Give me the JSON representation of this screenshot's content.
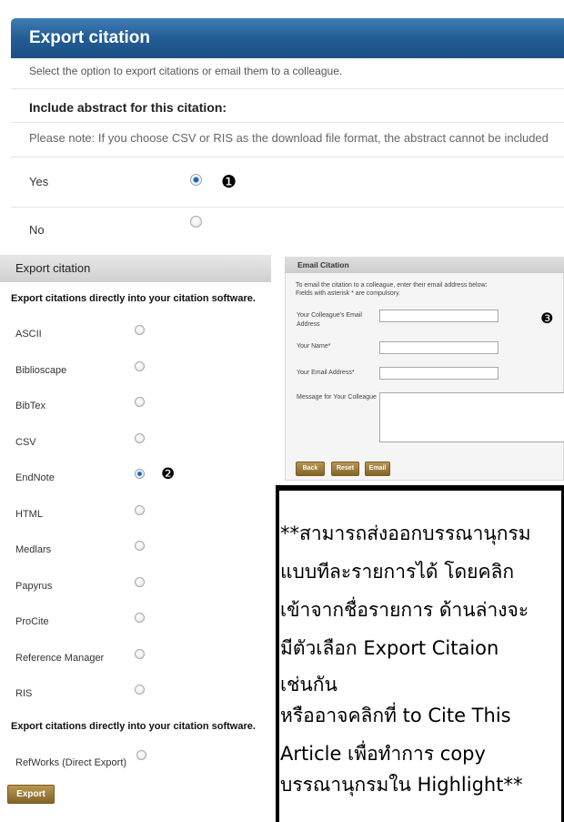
{
  "export_options": {
    "title": "Export citation",
    "intro": "Select the option to export citations or email them to a colleague.",
    "abstract_heading": "Include abstract for this citation:",
    "note": "Please note: If you choose CSV or RIS as the download file format, the abstract cannot be included",
    "choices": [
      {
        "label": "Yes",
        "selected": true
      },
      {
        "label": "No",
        "selected": false
      }
    ],
    "step_marker": "❶"
  },
  "format_panel": {
    "title": "Export citation",
    "software_heading": "Export citations directly into your citation software.",
    "formats": [
      {
        "label": "ASCII",
        "selected": false
      },
      {
        "label": "Biblioscape",
        "selected": false
      },
      {
        "label": "BibTex",
        "selected": false
      },
      {
        "label": "CSV",
        "selected": false
      },
      {
        "label": "EndNote",
        "selected": true
      },
      {
        "label": "HTML",
        "selected": false
      },
      {
        "label": "Medlars",
        "selected": false
      },
      {
        "label": "Papyrus",
        "selected": false
      },
      {
        "label": "ProCite",
        "selected": false
      },
      {
        "label": "Reference Manager",
        "selected": false
      },
      {
        "label": "RIS",
        "selected": false
      }
    ],
    "step_marker": "❷",
    "software_heading_2": "Export citations directly into your citation software.",
    "refworks": {
      "label": "RefWorks (Direct Export)",
      "selected": false
    },
    "export_button": "Export"
  },
  "email_panel": {
    "title": "Email Citation",
    "instructions": [
      "To email the citation to a colleague, enter their email address below:",
      "Fields with asterisk * are compulsory."
    ],
    "fields": [
      {
        "label": "Your Colleague's Email Address"
      },
      {
        "label": "Your Name*"
      },
      {
        "label": "Your Email Address*"
      },
      {
        "label": "Message for Your Colleague"
      }
    ],
    "step_marker": "❸",
    "buttons": [
      "Back",
      "Reset",
      "Email"
    ]
  },
  "note_box": {
    "lines": [
      "**สามารถส่งออกบรรณานุกรม",
      "แบบทีละรายการได้ โดยคลิก",
      "เข้าจากชื่อรายการ ด้านล่างจะ",
      "มีตัวเลือก Export Citaion",
      "เช่นกัน",
      "หรืออาจคลิกที่ to Cite This",
      "Article เพื่อทำการ copy",
      "บรรณานุกรมใน Highlight**"
    ]
  },
  "colors": {
    "header_blue": "#235d94",
    "button_brown": "#9c7b3c",
    "radio_selected": "#1f63b0"
  }
}
